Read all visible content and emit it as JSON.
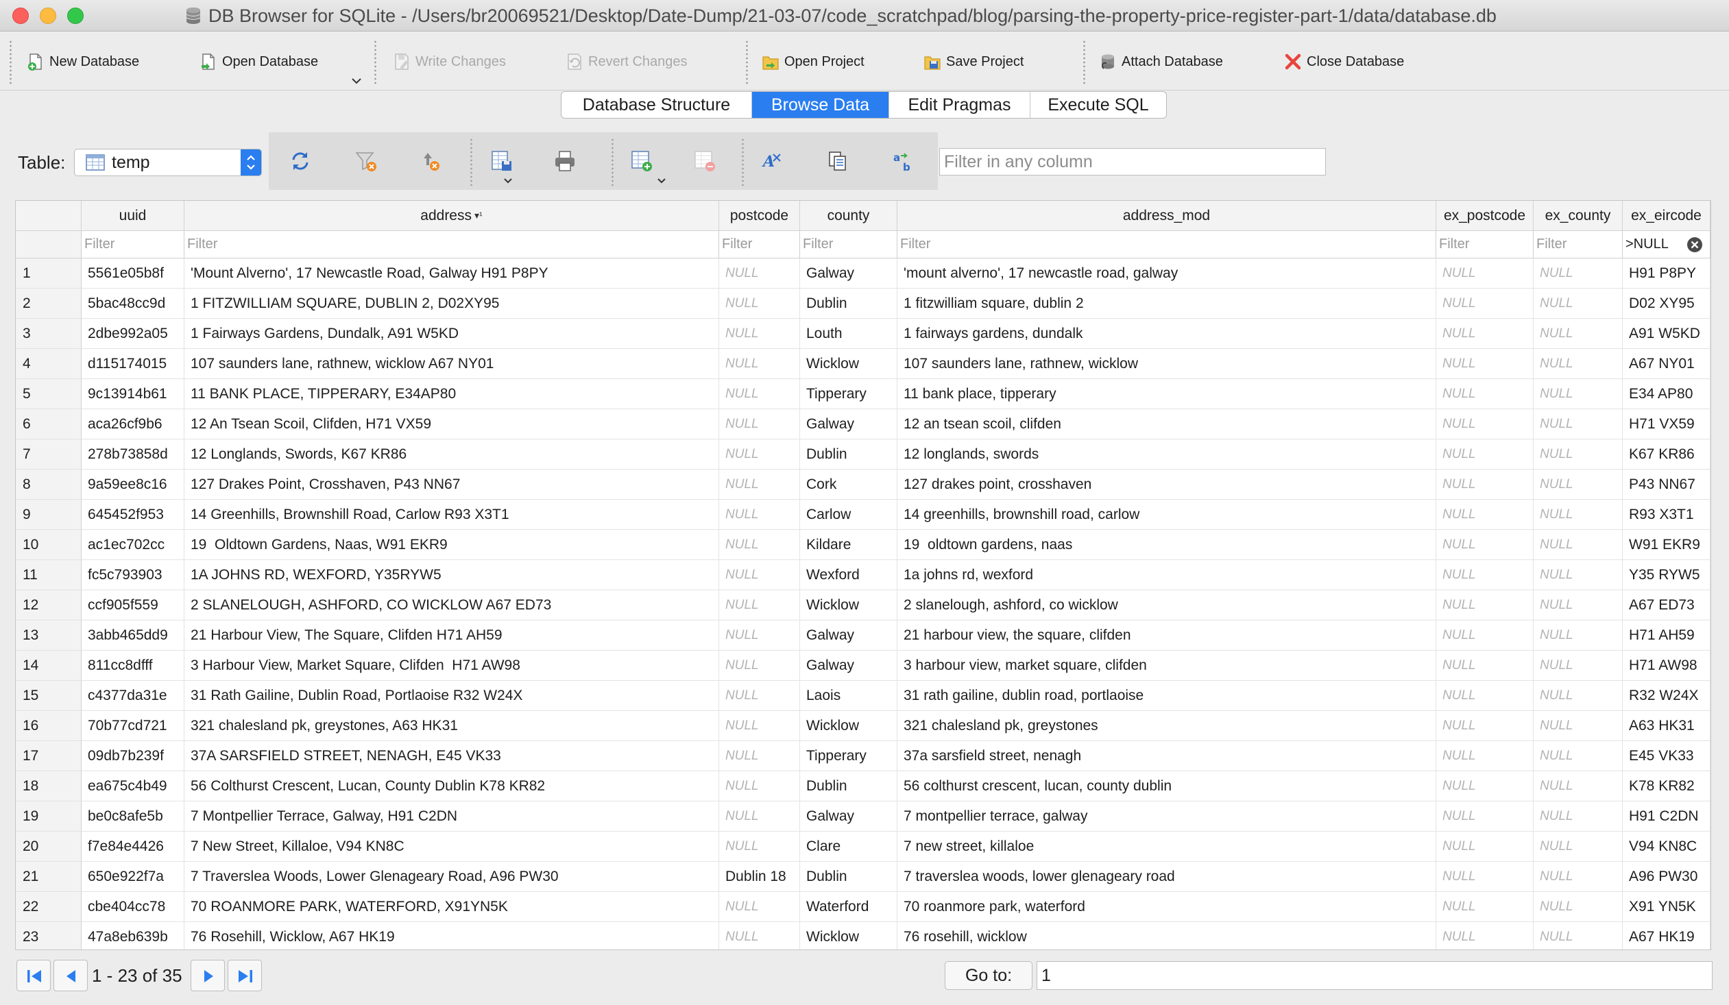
{
  "window": {
    "title": "DB Browser for SQLite - /Users/br20069521/Desktop/Date-Dump/21-03-07/code_scratchpad/blog/parsing-the-property-price-register-part-1/data/database.db"
  },
  "toolbar": {
    "new_database": "New Database",
    "open_database": "Open Database",
    "write_changes": "Write Changes",
    "revert_changes": "Revert Changes",
    "open_project": "Open Project",
    "save_project": "Save Project",
    "attach_database": "Attach Database",
    "close_database": "Close Database"
  },
  "tabs": [
    "Database Structure",
    "Browse Data",
    "Edit Pragmas",
    "Execute SQL"
  ],
  "browse": {
    "table_label": "Table:",
    "table_value": "temp",
    "filter_placeholder": "Filter in any column"
  },
  "grid": {
    "columns": [
      "uuid",
      "address",
      "postcode",
      "county",
      "address_mod",
      "ex_postcode",
      "ex_county",
      "ex_eircode"
    ],
    "sort_marker": "▾¹",
    "filter_placeholder": "Filter",
    "active_filter_value": ">NULL",
    "null_text": "NULL",
    "rows": [
      [
        "1",
        "5561e05b8f",
        "'Mount Alverno', 17 Newcastle Road, Galway H91 P8PY",
        null,
        "Galway",
        "'mount alverno', 17 newcastle road, galway",
        null,
        null,
        "H91 P8PY"
      ],
      [
        "2",
        "5bac48cc9d",
        "1 FITZWILLIAM SQUARE, DUBLIN 2, D02XY95",
        null,
        "Dublin",
        "1 fitzwilliam square, dublin 2",
        null,
        null,
        "D02 XY95"
      ],
      [
        "3",
        "2dbe992a05",
        "1 Fairways Gardens, Dundalk, A91 W5KD",
        null,
        "Louth",
        "1 fairways gardens, dundalk",
        null,
        null,
        "A91 W5KD"
      ],
      [
        "4",
        "d115174015",
        "107 saunders lane, rathnew, wicklow A67 NY01",
        null,
        "Wicklow",
        "107 saunders lane, rathnew, wicklow",
        null,
        null,
        "A67 NY01"
      ],
      [
        "5",
        "9c13914b61",
        "11 BANK PLACE, TIPPERARY, E34AP80",
        null,
        "Tipperary",
        "11 bank place, tipperary",
        null,
        null,
        "E34 AP80"
      ],
      [
        "6",
        "aca26cf9b6",
        "12 An Tsean Scoil, Clifden, H71 VX59",
        null,
        "Galway",
        "12 an tsean scoil, clifden",
        null,
        null,
        "H71 VX59"
      ],
      [
        "7",
        "278b73858d",
        "12 Longlands, Swords, K67 KR86",
        null,
        "Dublin",
        "12 longlands, swords",
        null,
        null,
        "K67 KR86"
      ],
      [
        "8",
        "9a59ee8c16",
        "127 Drakes Point, Crosshaven, P43 NN67",
        null,
        "Cork",
        "127 drakes point, crosshaven",
        null,
        null,
        "P43 NN67"
      ],
      [
        "9",
        "645452f953",
        "14 Greenhills, Brownshill Road, Carlow R93 X3T1",
        null,
        "Carlow",
        "14 greenhills, brownshill road, carlow",
        null,
        null,
        "R93 X3T1"
      ],
      [
        "10",
        "ac1ec702cc",
        "19  Oldtown Gardens, Naas, W91 EKR9",
        null,
        "Kildare",
        "19  oldtown gardens, naas",
        null,
        null,
        "W91 EKR9"
      ],
      [
        "11",
        "fc5c793903",
        "1A JOHNS RD, WEXFORD, Y35RYW5",
        null,
        "Wexford",
        "1a johns rd, wexford",
        null,
        null,
        "Y35 RYW5"
      ],
      [
        "12",
        "ccf905f559",
        "2 SLANELOUGH, ASHFORD, CO WICKLOW A67 ED73",
        null,
        "Wicklow",
        "2 slanelough, ashford, co wicklow",
        null,
        null,
        "A67 ED73"
      ],
      [
        "13",
        "3abb465dd9",
        "21 Harbour View, The Square, Clifden H71 AH59",
        null,
        "Galway",
        "21 harbour view, the square, clifden",
        null,
        null,
        "H71 AH59"
      ],
      [
        "14",
        "811cc8dfff",
        "3 Harbour View, Market Square, Clifden  H71 AW98",
        null,
        "Galway",
        "3 harbour view, market square, clifden",
        null,
        null,
        "H71 AW98"
      ],
      [
        "15",
        "c4377da31e",
        "31 Rath Gailine, Dublin Road, Portlaoise R32 W24X",
        null,
        "Laois",
        "31 rath gailine, dublin road, portlaoise",
        null,
        null,
        "R32 W24X"
      ],
      [
        "16",
        "70b77cd721",
        "321 chalesland pk, greystones, A63 HK31",
        null,
        "Wicklow",
        "321 chalesland pk, greystones",
        null,
        null,
        "A63 HK31"
      ],
      [
        "17",
        "09db7b239f",
        "37A SARSFIELD STREET, NENAGH, E45 VK33",
        null,
        "Tipperary",
        "37a sarsfield street, nenagh",
        null,
        null,
        "E45 VK33"
      ],
      [
        "18",
        "ea675c4b49",
        "56 Colthurst Crescent, Lucan, County Dublin K78 KR82",
        null,
        "Dublin",
        "56 colthurst crescent, lucan, county dublin",
        null,
        null,
        "K78 KR82"
      ],
      [
        "19",
        "be0c8afe5b",
        "7 Montpellier Terrace, Galway, H91 C2DN",
        null,
        "Galway",
        "7 montpellier terrace, galway",
        null,
        null,
        "H91 C2DN"
      ],
      [
        "20",
        "f7e84e4426",
        "7 New Street, Killaloe, V94 KN8C",
        null,
        "Clare",
        "7 new street, killaloe",
        null,
        null,
        "V94 KN8C"
      ],
      [
        "21",
        "650e922f7a",
        "7 Traverslea Woods, Lower Glenageary Road, A96 PW30",
        "Dublin 18",
        "Dublin",
        "7 traverslea woods, lower glenageary road",
        null,
        null,
        "A96 PW30"
      ],
      [
        "22",
        "cbe404cc78",
        "70 ROANMORE PARK, WATERFORD, X91YN5K",
        null,
        "Waterford",
        "70 roanmore park, waterford",
        null,
        null,
        "X91 YN5K"
      ],
      [
        "23",
        "47a8eb639b",
        "76 Rosehill, Wicklow, A67 HK19",
        null,
        "Wicklow",
        "76 rosehill, wicklow",
        null,
        null,
        "A67 HK19"
      ]
    ]
  },
  "footer": {
    "page_range": "1 - 23 of 35",
    "goto_label": "Go to:",
    "goto_value": "1"
  },
  "colors": {
    "accent": "#2a7ef0",
    "null_text": "#b3b3b3",
    "close_red": "#e8453c"
  }
}
